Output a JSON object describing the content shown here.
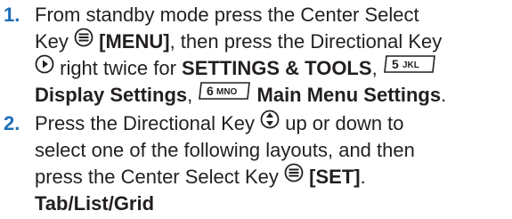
{
  "steps": [
    {
      "number": "1.",
      "lines": [
        {
          "segments": [
            {
              "text": "From standby mode press the Center Select"
            }
          ]
        },
        {
          "segments": [
            {
              "text": "Key "
            },
            {
              "icon": "center-select-icon"
            },
            {
              "text": " [MENU]",
              "bold": true
            },
            {
              "text": ", then press the Directional Key"
            }
          ]
        },
        {
          "segments": [
            {
              "icon": "directional-right-icon"
            },
            {
              "text": " right twice for "
            },
            {
              "text": "SETTINGS & TOOLS",
              "bold": true
            },
            {
              "text": ", "
            },
            {
              "keycap": "5 JKL"
            }
          ]
        },
        {
          "segments": [
            {
              "text": "Display Settings",
              "bold": true
            },
            {
              "text": ", "
            },
            {
              "keycap": "6 MNO"
            },
            {
              "text": " Main Menu Settings",
              "bold": true
            },
            {
              "text": "."
            }
          ]
        }
      ]
    },
    {
      "number": "2.",
      "lines": [
        {
          "segments": [
            {
              "text": "Press the Directional Key "
            },
            {
              "icon": "directional-updown-icon"
            },
            {
              "text": " up or down to"
            }
          ]
        },
        {
          "segments": [
            {
              "text": "select one of the following layouts, and then"
            }
          ]
        },
        {
          "segments": [
            {
              "text": "press the Center Select Key "
            },
            {
              "icon": "center-select-icon"
            },
            {
              "text": " [SET]",
              "bold": true
            },
            {
              "text": "."
            }
          ]
        },
        {
          "segments": [
            {
              "text": "Tab/List/Grid",
              "bold": true
            }
          ]
        }
      ]
    }
  ],
  "colors": {
    "step_number": "#1d6fb8",
    "body_text": "#231f20"
  }
}
